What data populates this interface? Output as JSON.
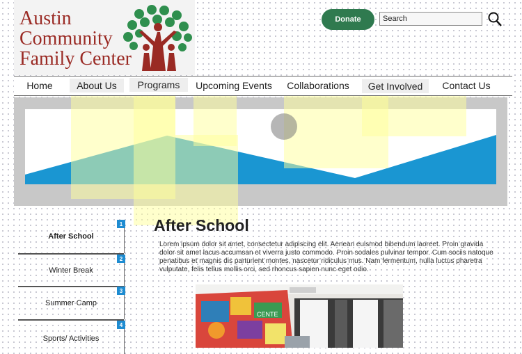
{
  "brand": {
    "logo_lines": [
      "Austin",
      "Community",
      "Family Center"
    ]
  },
  "header": {
    "donate_label": "Donate",
    "search_placeholder": "Search"
  },
  "nav": {
    "items": [
      {
        "label": "Home"
      },
      {
        "label": "About Us"
      },
      {
        "label": "Programs"
      },
      {
        "label": "Upcoming Events"
      },
      {
        "label": "Collaborations"
      },
      {
        "label": "Get Involved"
      },
      {
        "label": "Contact Us"
      }
    ]
  },
  "sidebar": {
    "items": [
      {
        "label": "After School",
        "badge": "1"
      },
      {
        "label": "Winter Break",
        "badge": "2"
      },
      {
        "label": "Summer Camp",
        "badge": "3"
      },
      {
        "label": "Sports/ Activities",
        "badge": "4"
      }
    ]
  },
  "main": {
    "title": "After School",
    "body": "Lorem ipsum dolor sit amet, consectetur adipiscing elit. Aenean euismod bibendum laoreet. Proin gravida dolor sit amet lacus accumsan et viverra justo commodo. Proin sodales pulvinar tempor. Cum sociis natoque penatibus et magnis dis parturient montes, nascetur ridiculus mus. Nam fermentum, nulla luctus pharetra vulputate, felis tellus mollis orci, sed rhoncus sapien nunc eget odio."
  },
  "colors": {
    "logo_red": "#9a2a24",
    "donate_green": "#2f7a4f",
    "banner_blue": "#1a96d2",
    "badge_blue": "#1e8cd1",
    "highlight_yellow": "#ffff99"
  },
  "icons": {
    "search": "magnifier-icon",
    "logo": "tree-family-icon"
  }
}
